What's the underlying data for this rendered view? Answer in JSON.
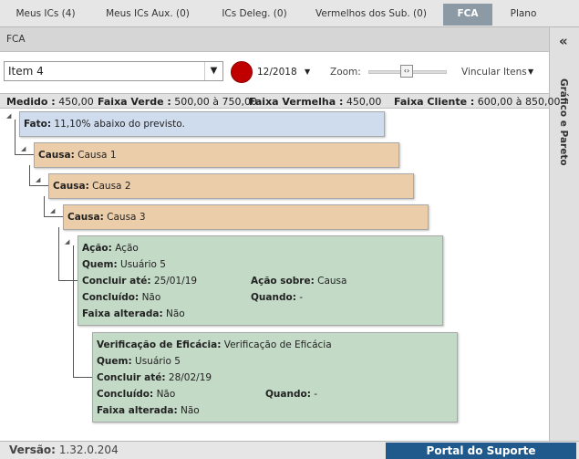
{
  "tabs": [
    {
      "label": "Meus ICs (4)",
      "active": false
    },
    {
      "label": "Meus ICs Aux. (0)",
      "active": false
    },
    {
      "label": "ICs Deleg. (0)",
      "active": false
    },
    {
      "label": "Vermelhos dos Sub. (0)",
      "active": false
    },
    {
      "label": "FCA",
      "active": true
    },
    {
      "label": "Plano",
      "active": false
    }
  ],
  "panel": {
    "title": "FCA",
    "collapse_icon": "chevrons-left-icon",
    "side_title": "Gráfico e Pareto"
  },
  "toolbar": {
    "item_value": "Item 4",
    "status_color": "#c00000",
    "period": "12/2018",
    "zoom_label": "Zoom:",
    "vincular_label": "Vincular Itens"
  },
  "ranges": {
    "medido_label": "Medido :",
    "medido_value": "450,00",
    "verde_label": "Faixa Verde :",
    "verde_value": "500,00 à 750,00",
    "vermelha_label": "Faixa Vermelha :",
    "vermelha_value": "450,00",
    "cliente_label": "Faixa Cliente :",
    "cliente_value": "600,00 à 850,00"
  },
  "tree": {
    "fato": {
      "label": "Fato:",
      "value": "11,10% abaixo do previsto."
    },
    "causas": [
      {
        "label": "Causa:",
        "value": "Causa 1"
      },
      {
        "label": "Causa:",
        "value": "Causa 2"
      },
      {
        "label": "Causa:",
        "value": "Causa 3"
      }
    ],
    "acao": {
      "acao_label": "Ação:",
      "acao_value": "Ação",
      "quem_label": "Quem:",
      "quem_value": "Usuário 5",
      "concluir_label": "Concluir até:",
      "concluir_value": "25/01/19",
      "acao_sobre_label": "Ação sobre:",
      "acao_sobre_value": "Causa",
      "concluido_label": "Concluído:",
      "concluido_value": "Não",
      "quando_label": "Quando:",
      "quando_value": "-",
      "faixa_label": "Faixa alterada:",
      "faixa_value": "Não"
    },
    "verificacao": {
      "verif_label": "Verificação de Eficácia:",
      "verif_value": "Verificação de Eficácia",
      "quem_label": "Quem:",
      "quem_value": "Usuário 5",
      "concluir_label": "Concluir até:",
      "concluir_value": "28/02/19",
      "concluido_label": "Concluído:",
      "concluido_value": "Não",
      "quando_label": "Quando:",
      "quando_value": "-",
      "faixa_label": "Faixa alterada:",
      "faixa_value": "Não"
    }
  },
  "footer": {
    "version_label": "Versão:",
    "version_value": "1.32.0.204",
    "portal_label": "Portal do Suporte"
  }
}
